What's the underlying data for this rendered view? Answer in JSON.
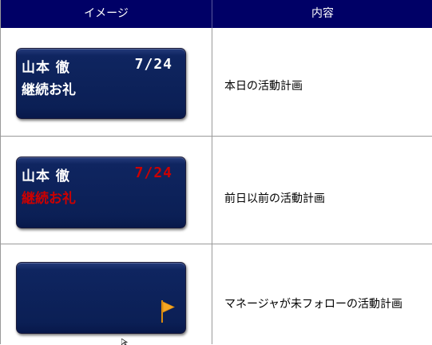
{
  "table": {
    "headers": [
      "イメージ",
      "内容"
    ],
    "rows": [
      {
        "card": {
          "name": "山本 徹",
          "date": "7/24",
          "item": "継続お礼",
          "state": "normal"
        },
        "description": "本日の活動計画"
      },
      {
        "card": {
          "name": "山本 徹",
          "date": "7/24",
          "item": "継続お礼",
          "state": "overdue"
        },
        "description": "前日以前の活動計画"
      },
      {
        "card": {
          "name": "",
          "date": "",
          "item": "",
          "state": "flagged",
          "icon": "flag-icon"
        },
        "description": "マネージャが未フォローの活動計画"
      }
    ]
  },
  "colors": {
    "header_bg": "#000066",
    "card_bg": "#0b1f55",
    "overdue_text": "#cc0000",
    "flag": "#f5a623"
  }
}
